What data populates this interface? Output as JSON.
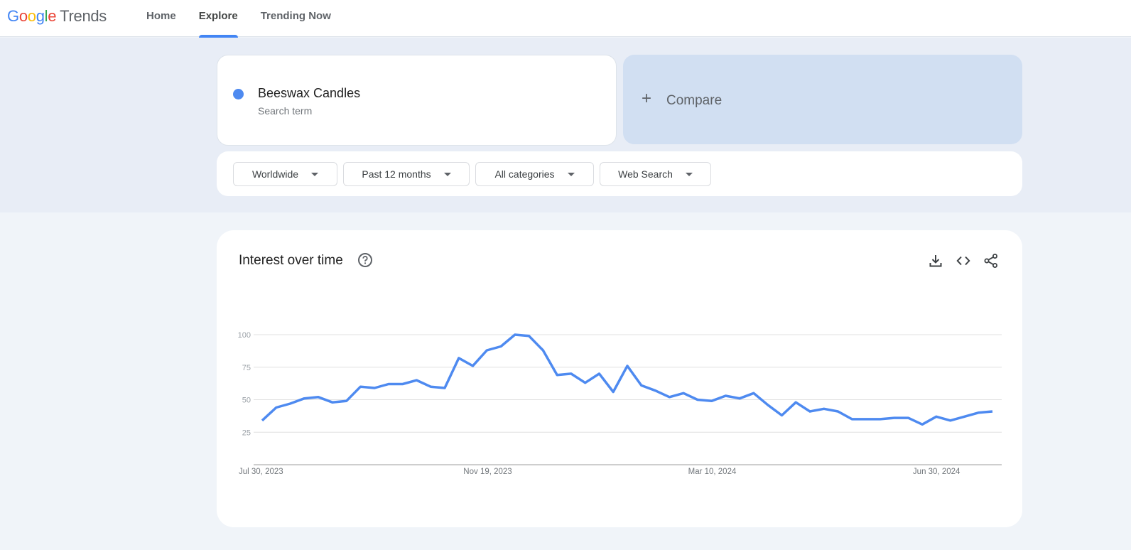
{
  "header": {
    "logo_google": [
      "G",
      "o",
      "o",
      "g",
      "l",
      "e"
    ],
    "logo_google_colors": [
      "#4285f4",
      "#ea4335",
      "#fbbc05",
      "#4285f4",
      "#34a853",
      "#ea4335"
    ],
    "logo_product": "Trends",
    "nav": [
      {
        "label": "Home",
        "active": false
      },
      {
        "label": "Explore",
        "active": true
      },
      {
        "label": "Trending Now",
        "active": false
      }
    ]
  },
  "search": {
    "term": "Beeswax Candles",
    "term_type": "Search term",
    "term_color": "#4e8af0",
    "compare_icon": "plus-icon",
    "compare_label": "Compare"
  },
  "filters": [
    {
      "label": "Worldwide",
      "icon": "caret-down-icon"
    },
    {
      "label": "Past 12 months",
      "icon": "caret-down-icon"
    },
    {
      "label": "All categories",
      "icon": "caret-down-icon"
    },
    {
      "label": "Web Search",
      "icon": "caret-down-icon"
    }
  ],
  "interest_card": {
    "title": "Interest over time",
    "help_icon": "help-circle-icon",
    "tools": [
      "download-icon",
      "embed-code-icon",
      "share-icon"
    ]
  },
  "chart_data": {
    "type": "line",
    "title": "Interest over time",
    "xlabel": "",
    "ylabel": "",
    "ylim": [
      0,
      100
    ],
    "yticks": [
      25,
      50,
      75,
      100
    ],
    "xtick_labels": [
      {
        "label": "Jul 30, 2023",
        "index": 0
      },
      {
        "label": "Nov 19, 2023",
        "index": 16
      },
      {
        "label": "Mar 10, 2024",
        "index": 32
      },
      {
        "label": "Jun 30, 2024",
        "index": 48
      }
    ],
    "grid": true,
    "legend": "none",
    "series": [
      {
        "name": "Beeswax Candles",
        "color": "#4e8af0",
        "values": [
          34,
          44,
          47,
          51,
          52,
          48,
          49,
          60,
          59,
          62,
          62,
          65,
          60,
          59,
          82,
          76,
          88,
          91,
          100,
          99,
          88,
          69,
          70,
          63,
          70,
          56,
          76,
          61,
          57,
          52,
          55,
          50,
          49,
          53,
          51,
          55,
          46,
          38,
          48,
          41,
          43,
          41,
          35,
          35,
          35,
          36,
          36,
          31,
          37,
          34,
          37,
          40,
          41
        ]
      }
    ]
  }
}
